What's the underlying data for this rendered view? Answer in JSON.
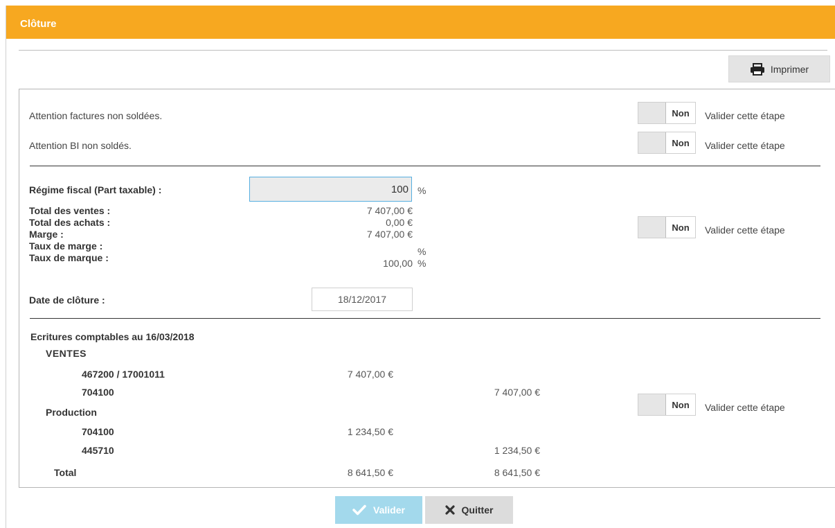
{
  "window": {
    "title": "Clôture"
  },
  "toolbar": {
    "print_label": "Imprimer"
  },
  "steps": {
    "toggle_value": "Non",
    "validate_label": "Valider cette étape"
  },
  "warnings": {
    "invoices": "Attention factures non soldées.",
    "bi": "Attention BI non soldés."
  },
  "fiscal": {
    "regime_label": "Régime fiscal (Part taxable) :",
    "regime_value": "100",
    "percent": "%",
    "rows": [
      {
        "label": "Total des ventes :",
        "value": "7 407,00 €",
        "unit": ""
      },
      {
        "label": "Total des achats :",
        "value": "0,00 €",
        "unit": ""
      },
      {
        "label": "Marge :",
        "value": "7 407,00 €",
        "unit": ""
      },
      {
        "label": "Taux de marge :",
        "value": "",
        "unit": "%"
      },
      {
        "label": "Taux de marque :",
        "value": "100,00",
        "unit": "%"
      }
    ],
    "date_label": "Date de clôture :",
    "date_value": "18/12/2017"
  },
  "entries": {
    "title": "Ecritures comptables au 16/03/2018",
    "journals": [
      {
        "name": "VENTES",
        "lines": [
          {
            "account": "467200 / 17001011",
            "debit": "7 407,00 €",
            "credit": ""
          },
          {
            "account": "704100",
            "debit": "",
            "credit": "7 407,00 €"
          }
        ]
      },
      {
        "name": "Production",
        "lines": [
          {
            "account": "704100",
            "debit": "1 234,50 €",
            "credit": ""
          },
          {
            "account": "445710",
            "debit": "",
            "credit": "1 234,50 €"
          }
        ]
      }
    ],
    "total_label": "Total",
    "total_debit": "8 641,50 €",
    "total_credit": "8 641,50 €"
  },
  "footer": {
    "validate_label": "Valider",
    "quit_label": "Quitter"
  },
  "colors": {
    "header": "#f7a820",
    "validate_button": "#a3d9ec",
    "focus_border": "#55aee0"
  }
}
